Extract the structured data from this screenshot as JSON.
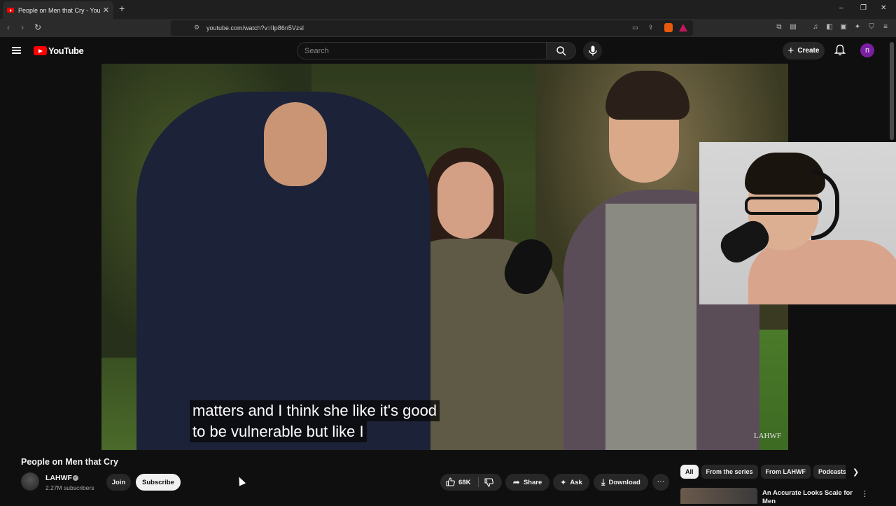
{
  "browser": {
    "tab_title": "People on Men that Cry - YouTube",
    "new_tab": "+",
    "url": "youtube.com/watch?v=lIp86n5Vzsl",
    "window_controls": [
      "–",
      "❐",
      "✕"
    ]
  },
  "header": {
    "logo_text": "YouTube",
    "search_placeholder": "Search",
    "create_label": "Create",
    "avatar_initial": "n"
  },
  "video": {
    "caption_line1": "matters and I think she like it's good",
    "caption_line2": "to be vulnerable but like I",
    "watermark": "LAHWF"
  },
  "details": {
    "title": "People on Men that Cry",
    "channel_name": "LAHWF",
    "subscribers": "2.27M subscribers",
    "join_label": "Join",
    "subscribe_label": "Subscribe",
    "like_count": "68K",
    "share_label": "Share",
    "ask_label": "Ask",
    "download_label": "Download",
    "more_label": "···"
  },
  "sidebar": {
    "chips": [
      "All",
      "From the series",
      "From LAHWF",
      "Podcasts"
    ],
    "recommended_title": "An Accurate Looks Scale for Men"
  },
  "colors": {
    "accent_red": "#ff0000",
    "background": "#0f0f0f",
    "avatar_purple": "#7b1fa2"
  }
}
